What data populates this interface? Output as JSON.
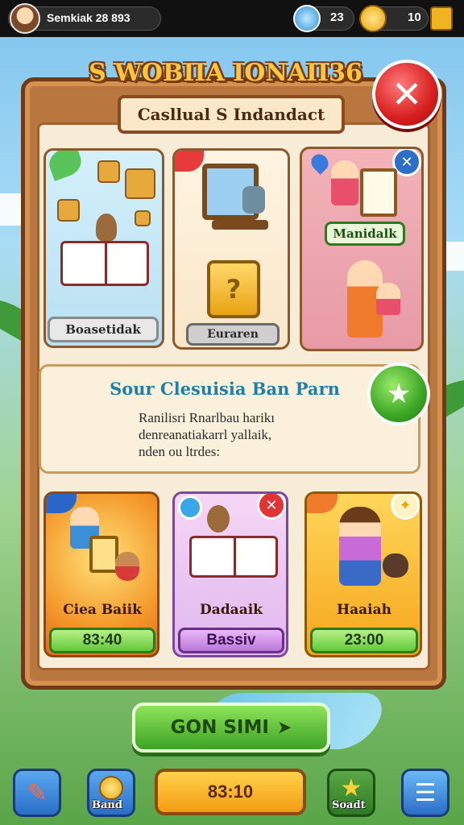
{
  "header": {
    "profile_name": "Semkiak 28 893",
    "gems": "23",
    "coins": "10"
  },
  "title": "S WOBIIA IONAII36",
  "subtitle": "Casllual S Indandact",
  "top_cards": [
    {
      "label": "Boasetidak"
    },
    {
      "label": "Euraren"
    },
    {
      "label": "Manidalk"
    }
  ],
  "quest": {
    "title": "Sour Clesuisia Ban Parn",
    "lines": [
      "Ranilisri Rnarlbau harikı",
      "denreanatiakarrl yallaik,",
      "nden ou ltrdes:"
    ]
  },
  "bottom_cards": [
    {
      "title": "Ciea Baiik",
      "price": "83:40"
    },
    {
      "title": "Dadaaik",
      "price": "Bassiv"
    },
    {
      "title": "Haaiah",
      "price": "23:00"
    }
  ],
  "go_button_label": "GON SIMI",
  "nav": {
    "left_label": "",
    "sand_label": "Band",
    "center_value": "83:10",
    "star_label": "Soadt",
    "menu_label": ""
  },
  "colors": {
    "accent_green": "#3da325",
    "close_red": "#d81e1e",
    "board_brown": "#b9763e",
    "title_gold": "#ffc53d"
  }
}
